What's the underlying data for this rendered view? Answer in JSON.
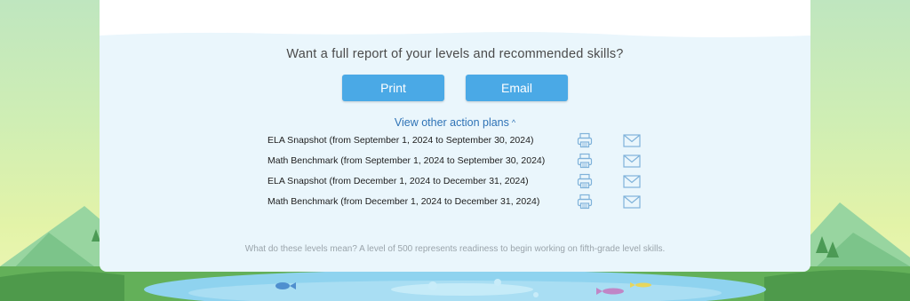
{
  "report_prompt": "Want a full report of your levels and recommended skills?",
  "buttons": {
    "print_label": "Print",
    "email_label": "Email"
  },
  "other_plans_link": {
    "label": "View other action plans",
    "caret": "^"
  },
  "action_plans": [
    {
      "label": "ELA Snapshot (from September 1, 2024 to September 30, 2024)",
      "print_icon": "printer-icon",
      "email_icon": "envelope-icon"
    },
    {
      "label": "Math Benchmark (from September 1, 2024 to September 30, 2024)",
      "print_icon": "printer-icon",
      "email_icon": "envelope-icon"
    },
    {
      "label": "ELA Snapshot (from December 1, 2024 to December 31, 2024)",
      "print_icon": "printer-icon",
      "email_icon": "envelope-icon"
    },
    {
      "label": "Math Benchmark (from December 1, 2024 to December 31, 2024)",
      "print_icon": "printer-icon",
      "email_icon": "envelope-icon"
    }
  ],
  "footnote": "What do these levels mean? A level of 500 represents readiness to begin working on fifth-grade level skills.",
  "colors": {
    "button_bg": "#4aa9e6",
    "link": "#2f73b6",
    "card_bg": "#eaf6fc",
    "icon_stroke": "#7fb2da"
  }
}
